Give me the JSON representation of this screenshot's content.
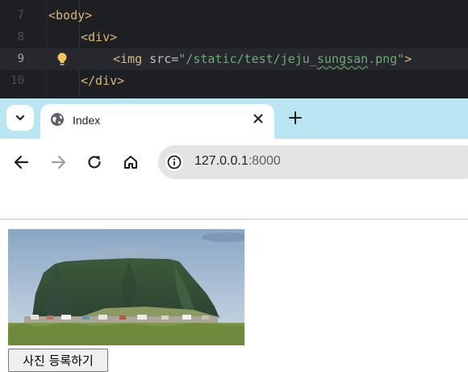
{
  "editor": {
    "lines": [
      {
        "number": "7",
        "tag_open": "<body>"
      },
      {
        "number": "8",
        "tag_open": "<div>"
      },
      {
        "number": "9",
        "tag": "<img",
        "attr": "src",
        "eq": "=",
        "value": "\"/static/test/jeju_sungsan.png\"",
        "close": ">"
      },
      {
        "number": "10",
        "tag_close": "</div>"
      }
    ]
  },
  "browser": {
    "tab": {
      "title": "Index"
    },
    "address": {
      "host": "127.0.0.1",
      "port": ":8000"
    }
  },
  "page": {
    "upload_button_label": "사진 등록하기"
  },
  "colors": {
    "tabstrip": "#b9e6f2",
    "editor_bg": "#1e1f22",
    "tag": "#d5b778",
    "string": "#6aab73"
  },
  "icons": [
    "tab-search-chevron-icon",
    "globe-icon",
    "close-icon",
    "plus-icon",
    "back-arrow-icon",
    "forward-arrow-icon",
    "reload-icon",
    "home-icon",
    "info-icon",
    "lightbulb-icon"
  ]
}
